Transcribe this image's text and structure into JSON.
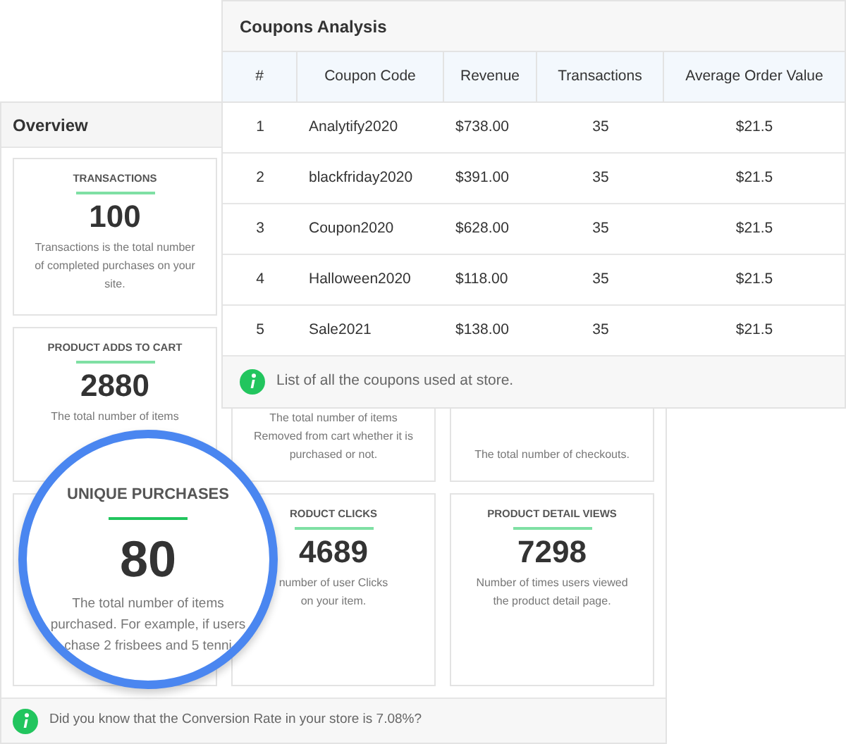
{
  "overview": {
    "title": "Overview",
    "cards": [
      {
        "kind": "stat",
        "title": "TRANSACTIONS",
        "value": "100",
        "lines": [
          "Transactions is the total number",
          "of completed purchases on your",
          "site."
        ]
      },
      {
        "kind": "stat",
        "title": "PRODUCT ADDS TO CART",
        "value": "2880",
        "lines": [
          "The total number of items"
        ]
      },
      {
        "kind": "stat",
        "lines": [
          "The total number of items",
          "Removed from cart whether it is",
          "purchased or not."
        ]
      },
      {
        "kind": "stat",
        "lines": [
          "The total number of checkouts."
        ]
      },
      {
        "kind": "magnified",
        "title": "UNIQUE PURCHASES",
        "value": "80",
        "lines": [
          "The total number of items",
          "purchased. For example, if users",
          "chase 2 frisbees and 5 tenni"
        ]
      },
      {
        "kind": "stat",
        "title": "RODUCT CLICKS",
        "value": "4689",
        "lines": [
          "number of user Clicks",
          "on your item."
        ]
      },
      {
        "kind": "stat",
        "title": "PRODUCT DETAIL VIEWS",
        "value": "7298",
        "lines": [
          "Number of times users viewed",
          "the product detail page."
        ]
      }
    ],
    "footer": "Did you know that the Conversion Rate in your store is 7.08%?"
  },
  "coupons": {
    "title": "Coupons Analysis",
    "columns": [
      "#",
      "Coupon Code",
      "Revenue",
      "Transactions",
      "Average Order Value"
    ],
    "rows": [
      [
        "1",
        "Analytify2020",
        "$738.00",
        "35",
        "$21.5"
      ],
      [
        "2",
        "blackfriday2020",
        "$391.00",
        "35",
        "$21.5"
      ],
      [
        "3",
        "Coupon2020",
        "$628.00",
        "35",
        "$21.5"
      ],
      [
        "4",
        "Halloween2020",
        "$118.00",
        "35",
        "$21.5"
      ],
      [
        "5",
        "Sale2021",
        "$138.00",
        "35",
        "$21.5"
      ]
    ],
    "footer": "List of all the coupons used at store."
  }
}
